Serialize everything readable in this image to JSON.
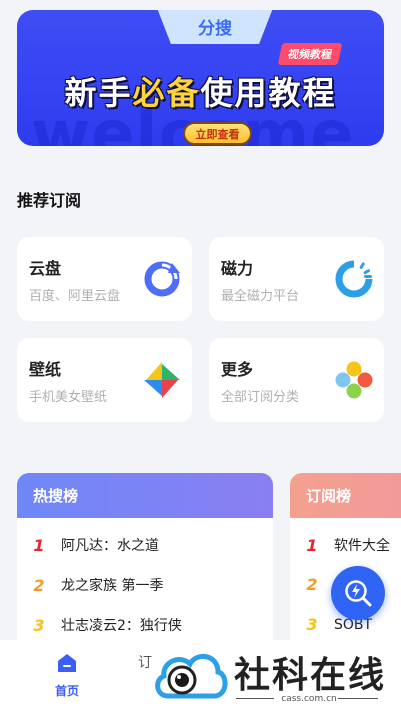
{
  "banner": {
    "tab_label": "分搜",
    "badge": "视频教程",
    "title_part1": "新手",
    "title_highlight": "必备",
    "title_part2": "使用教程",
    "button": "立即查看",
    "watermark": "welcome"
  },
  "section": {
    "title": "推荐订阅"
  },
  "cards": [
    {
      "title": "云盘",
      "subtitle": "百度、阿里云盘",
      "icon": "cloud-disk-refresh-icon"
    },
    {
      "title": "磁力",
      "subtitle": "最全磁力平台",
      "icon": "magnet-loader-icon"
    },
    {
      "title": "壁纸",
      "subtitle": "手机美女壁纸",
      "icon": "pinwheel-icon"
    },
    {
      "title": "更多",
      "subtitle": "全部订阅分类",
      "icon": "color-dots-icon"
    }
  ],
  "hot_rank": {
    "title": "热搜榜",
    "items": [
      {
        "rank": "1",
        "name": "阿凡达：水之道"
      },
      {
        "rank": "2",
        "name": "龙之家族 第一季"
      },
      {
        "rank": "3",
        "name": "壮志凌云2：独行侠"
      }
    ]
  },
  "sub_rank": {
    "title": "订阅榜",
    "items": [
      {
        "rank": "1",
        "name": "软件大全"
      },
      {
        "rank": "2",
        "name": ""
      },
      {
        "rank": "3",
        "name": "SOBT"
      }
    ]
  },
  "bottom_nav": {
    "home_label": "首页",
    "second_label": "订"
  },
  "site_watermark": {
    "text": "社科在线",
    "domain": "cass.com.cn"
  },
  "colors": {
    "accent": "#3b5ff5",
    "rank1": "#e8262e",
    "rank2": "#f59a23",
    "rank3": "#f5c518"
  }
}
